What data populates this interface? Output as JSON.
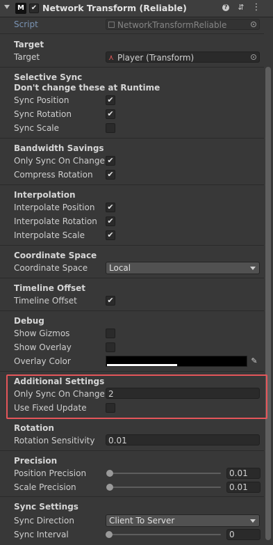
{
  "header": {
    "title": "Network Transform (Reliable)",
    "component_icon": "mirror-m-icon",
    "enabled": true
  },
  "script_row": {
    "label": "Script",
    "value": "NetworkTransformReliable"
  },
  "target": {
    "section": "Target",
    "label": "Target",
    "value": "Player (Transform)"
  },
  "selective_sync": {
    "section_line1": "Selective Sync",
    "section_line2": "Don't change these at Runtime",
    "sync_position": {
      "label": "Sync Position",
      "checked": true
    },
    "sync_rotation": {
      "label": "Sync Rotation",
      "checked": true
    },
    "sync_scale": {
      "label": "Sync Scale",
      "checked": false
    }
  },
  "bandwidth": {
    "section": "Bandwidth Savings",
    "only_sync_on_change": {
      "label": "Only Sync On Change",
      "checked": true
    },
    "compress_rotation": {
      "label": "Compress Rotation",
      "checked": true
    }
  },
  "interpolation": {
    "section": "Interpolation",
    "position": {
      "label": "Interpolate Position",
      "checked": true
    },
    "rotation": {
      "label": "Interpolate Rotation",
      "checked": true
    },
    "scale": {
      "label": "Interpolate Scale",
      "checked": true
    }
  },
  "coordinate_space": {
    "section": "Coordinate Space",
    "label": "Coordinate Space",
    "value": "Local"
  },
  "timeline_offset": {
    "section": "Timeline Offset",
    "label": "Timeline Offset",
    "checked": true
  },
  "debug": {
    "section": "Debug",
    "show_gizmos": {
      "label": "Show Gizmos",
      "checked": false
    },
    "show_overlay": {
      "label": "Show Overlay",
      "checked": false
    },
    "overlay_color": {
      "label": "Overlay Color",
      "color": "#000000"
    }
  },
  "additional_settings": {
    "section": "Additional Settings",
    "only_sync_on_change_threshold": {
      "label": "Only Sync On Change C",
      "value": "2"
    },
    "use_fixed_update": {
      "label": "Use Fixed Update",
      "checked": false
    }
  },
  "rotation": {
    "section": "Rotation",
    "label": "Rotation Sensitivity",
    "value": "0.01"
  },
  "precision": {
    "section": "Precision",
    "position_precision": {
      "label": "Position Precision",
      "value": "0.01"
    },
    "scale_precision": {
      "label": "Scale Precision",
      "value": "0.01"
    }
  },
  "sync_settings": {
    "section": "Sync Settings",
    "sync_direction": {
      "label": "Sync Direction",
      "value": "Client To Server"
    },
    "sync_interval": {
      "label": "Sync Interval",
      "value": "0"
    }
  },
  "check_glyph": "✔",
  "colors": {
    "highlight": "#e5565a",
    "background": "#383838"
  }
}
